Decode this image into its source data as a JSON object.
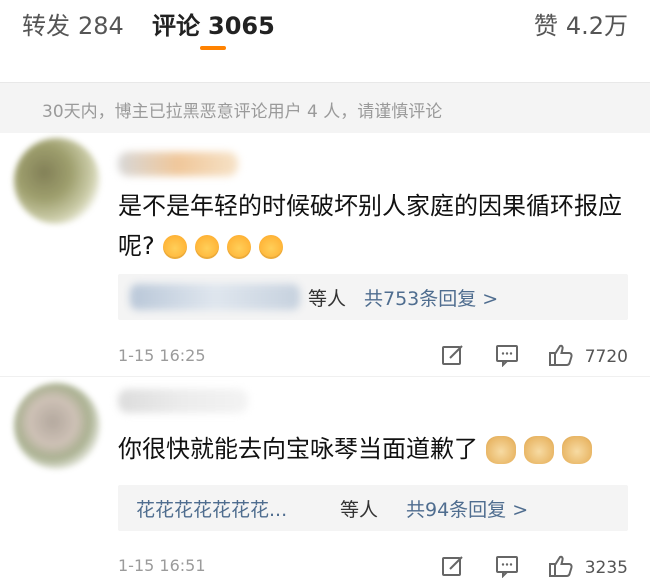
{
  "tabs": {
    "repost": {
      "label": "转发",
      "count": "284"
    },
    "comment": {
      "label": "评论",
      "count": "3065"
    },
    "like": {
      "label": "赞",
      "count": "4.2万"
    }
  },
  "notice": "30天内，博主已拉黑恶意评论用户 4 人，请谨慎评论",
  "comments": [
    {
      "text": "是不是年轻的时候破坏别人家庭的因果循环报应呢?",
      "emojis": [
        "blush-emoji",
        "blush-emoji",
        "blush-emoji",
        "blush-emoji"
      ],
      "replies": {
        "names": "",
        "etc": "等人",
        "count": "共753条回复 >"
      },
      "time": "1-15 16:25",
      "likes": "7720"
    },
    {
      "text": "你很快就能去向宝咏琴当面道歉了",
      "emojis": [
        "doge-emoji",
        "doge-emoji",
        "doge-emoji"
      ],
      "replies": {
        "names": "花花花花花花花...",
        "etc": "等人",
        "count": "共94条回复 >"
      },
      "time": "1-15 16:51",
      "likes": "3235"
    }
  ],
  "colors": {
    "accent": "#ff8200",
    "link": "#4f6d8f"
  },
  "icons": [
    "repost-icon",
    "comment-icon",
    "thumbs-up-icon"
  ]
}
